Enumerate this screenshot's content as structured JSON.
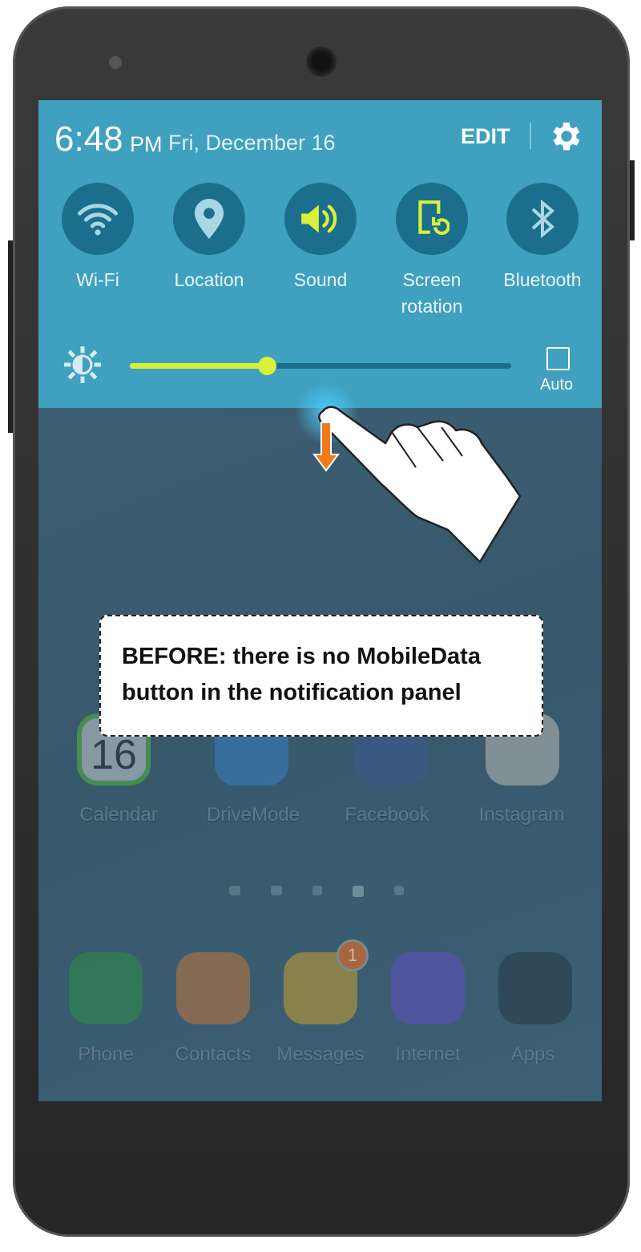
{
  "status": {
    "time": "6:48",
    "ampm": "PM",
    "date": "Fri, December 16",
    "edit_label": "EDIT"
  },
  "quick_settings": [
    {
      "label": "Wi-Fi",
      "icon": "wifi-icon",
      "active": false
    },
    {
      "label": "Location",
      "icon": "location-icon",
      "active": false
    },
    {
      "label": "Sound",
      "icon": "sound-icon",
      "active": true
    },
    {
      "label": "Screen rotation",
      "icon": "screen-rotation-icon",
      "active": true
    },
    {
      "label": "Bluetooth",
      "icon": "bluetooth-icon",
      "active": false
    }
  ],
  "brightness": {
    "level": 0.36,
    "auto_label": "Auto",
    "auto_checked": false
  },
  "home_apps": [
    "Calendar",
    "DriveMode",
    "Facebook",
    "Instagram"
  ],
  "calendar_day": "16",
  "dock_apps": [
    "Phone",
    "Contacts",
    "Messages",
    "Internet",
    "Apps"
  ],
  "messages_badge": "1",
  "callout": {
    "line1": "BEFORE: there is no MobileData",
    "line2": "button in the notification panel"
  },
  "colors": {
    "panel": "#3fa0c0",
    "tile": "#1b6f8c",
    "accent": "#d8f03a",
    "arrow": "#f07a1a"
  }
}
